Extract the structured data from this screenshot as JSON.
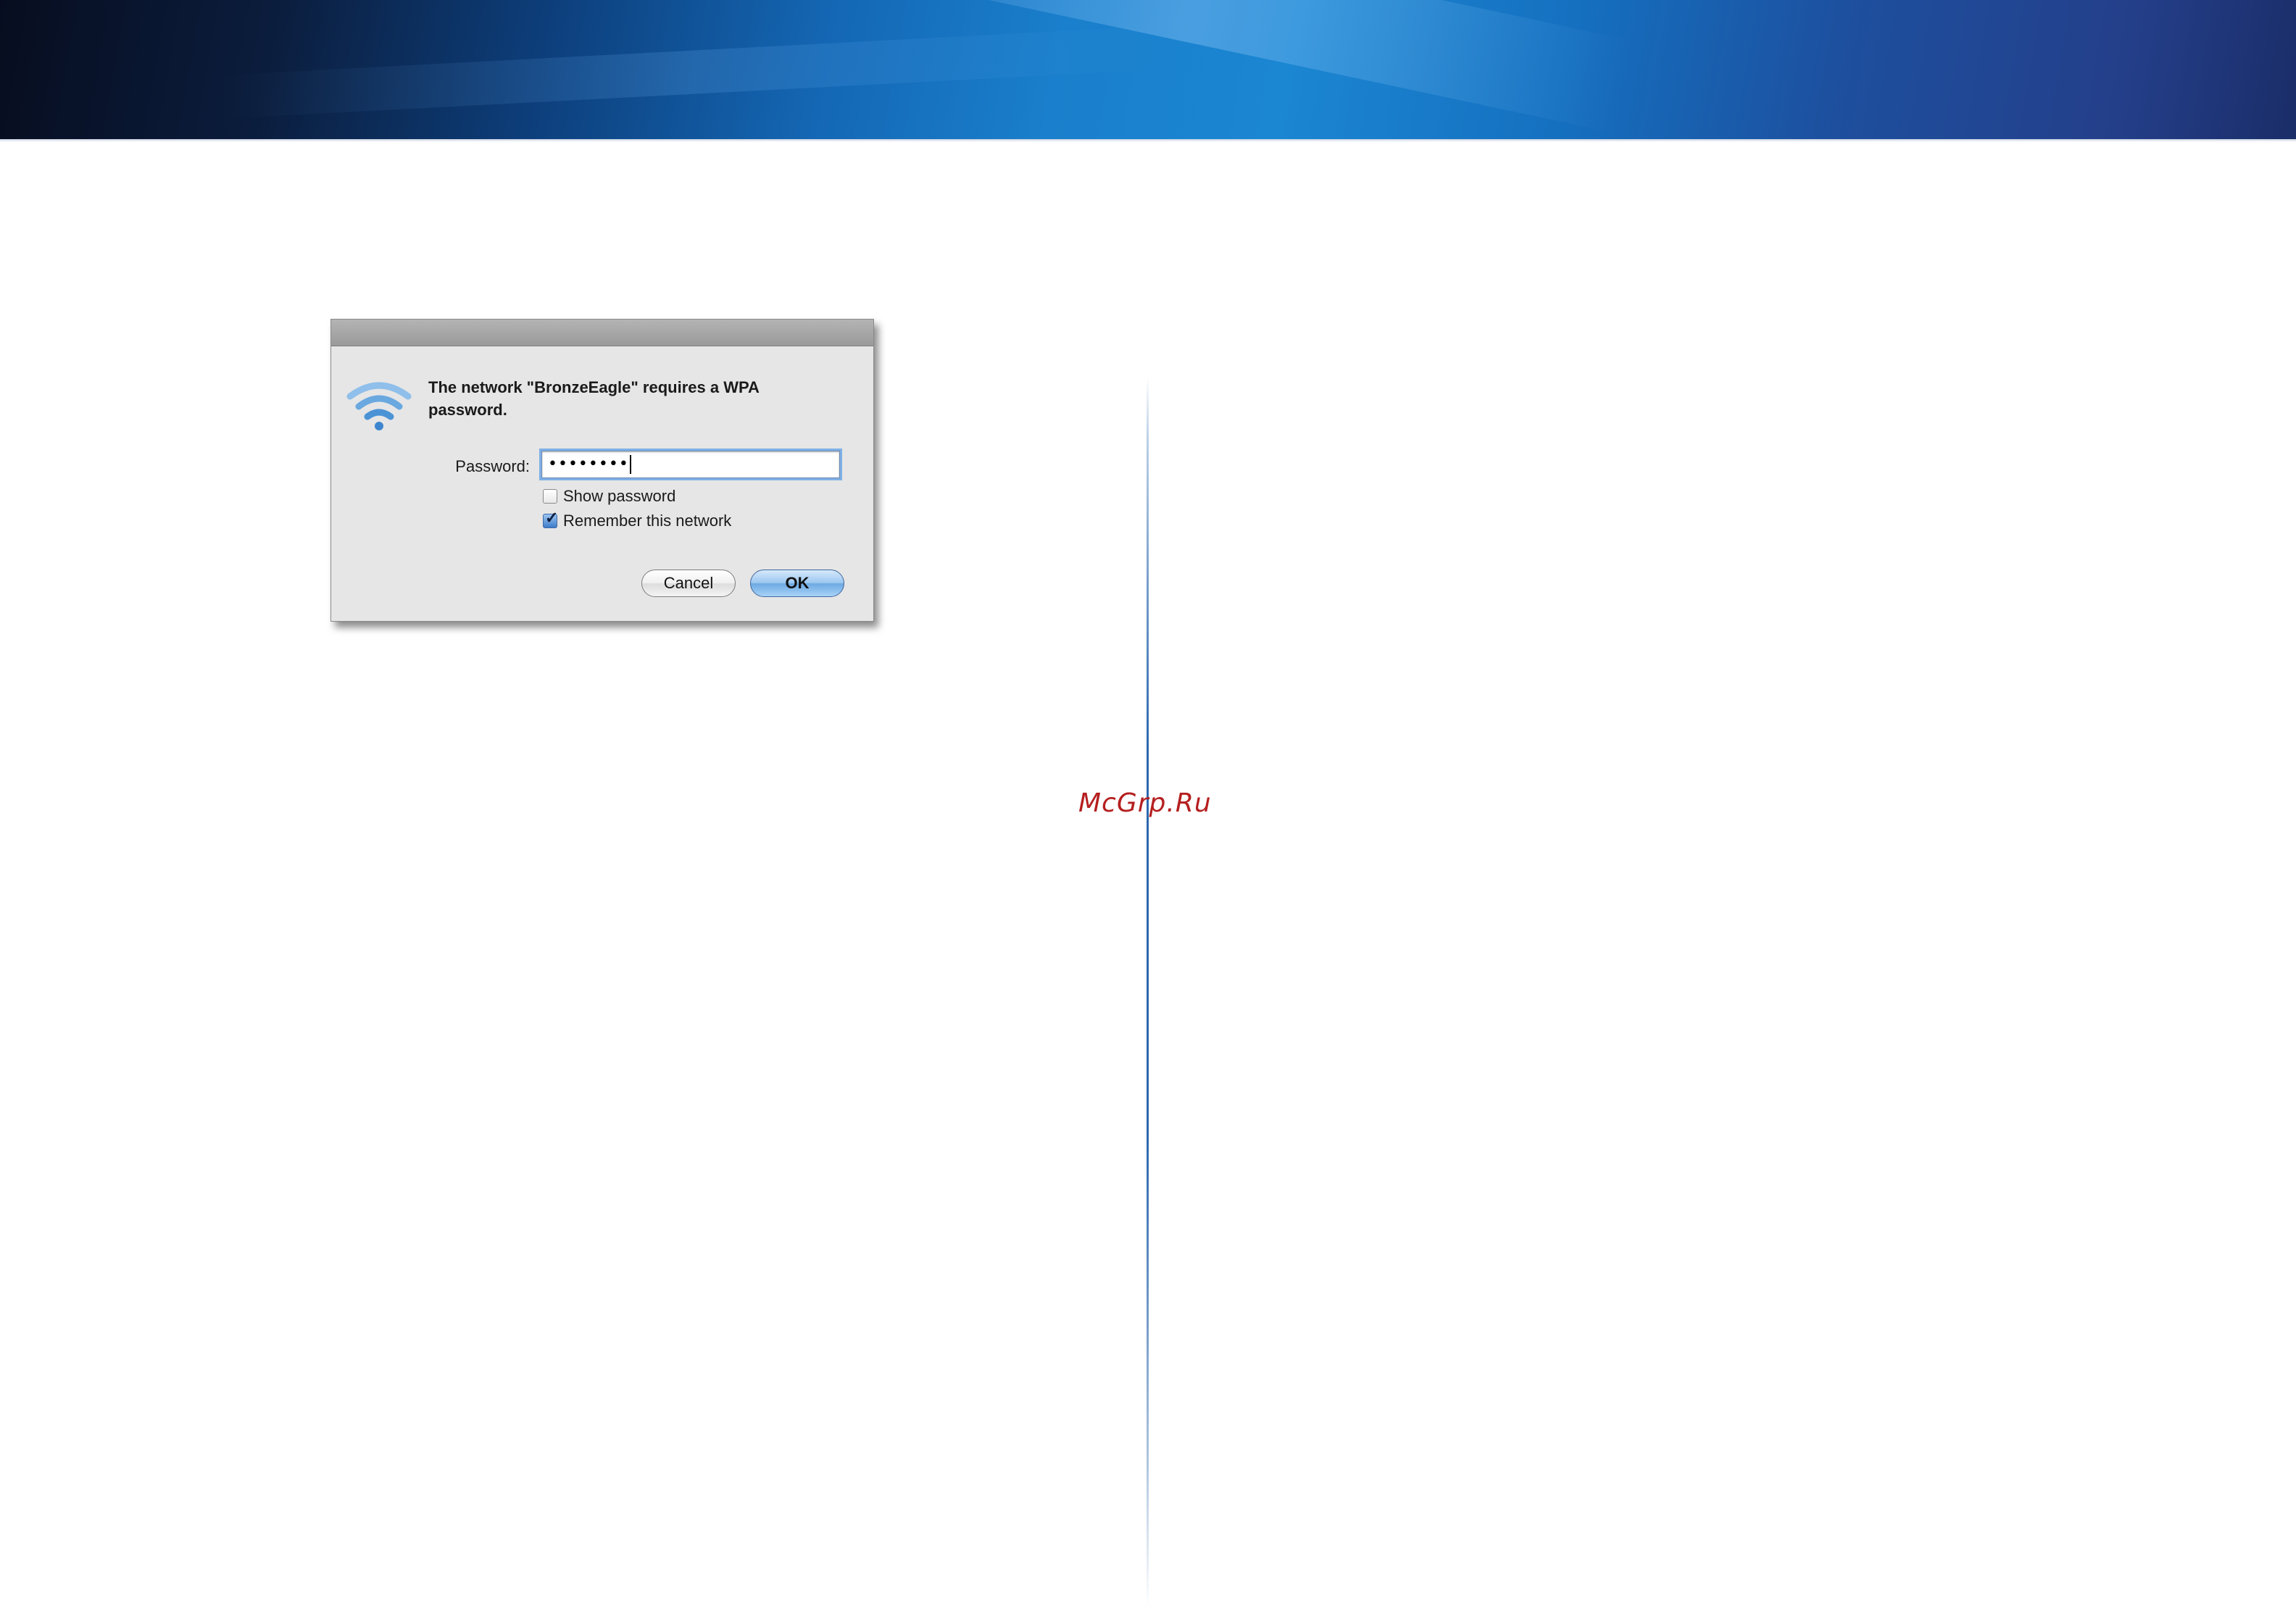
{
  "watermark": "McGrp.Ru",
  "dialog": {
    "icon": "wifi-icon",
    "message_line1": "The network \"BronzeEagle\" requires a WPA",
    "message_line2": "password.",
    "password_label": "Password:",
    "password_value": "••••••••",
    "show_password_label": "Show password",
    "show_password_checked": false,
    "remember_label": "Remember this network",
    "remember_checked": true,
    "cancel_label": "Cancel",
    "ok_label": "OK"
  },
  "colors": {
    "banner_dark": "#0b1d3d",
    "banner_blue": "#1a7fcc",
    "divider": "#2d68b0",
    "watermark": "#b51f1f",
    "ok_button": "#6ea9e3"
  }
}
